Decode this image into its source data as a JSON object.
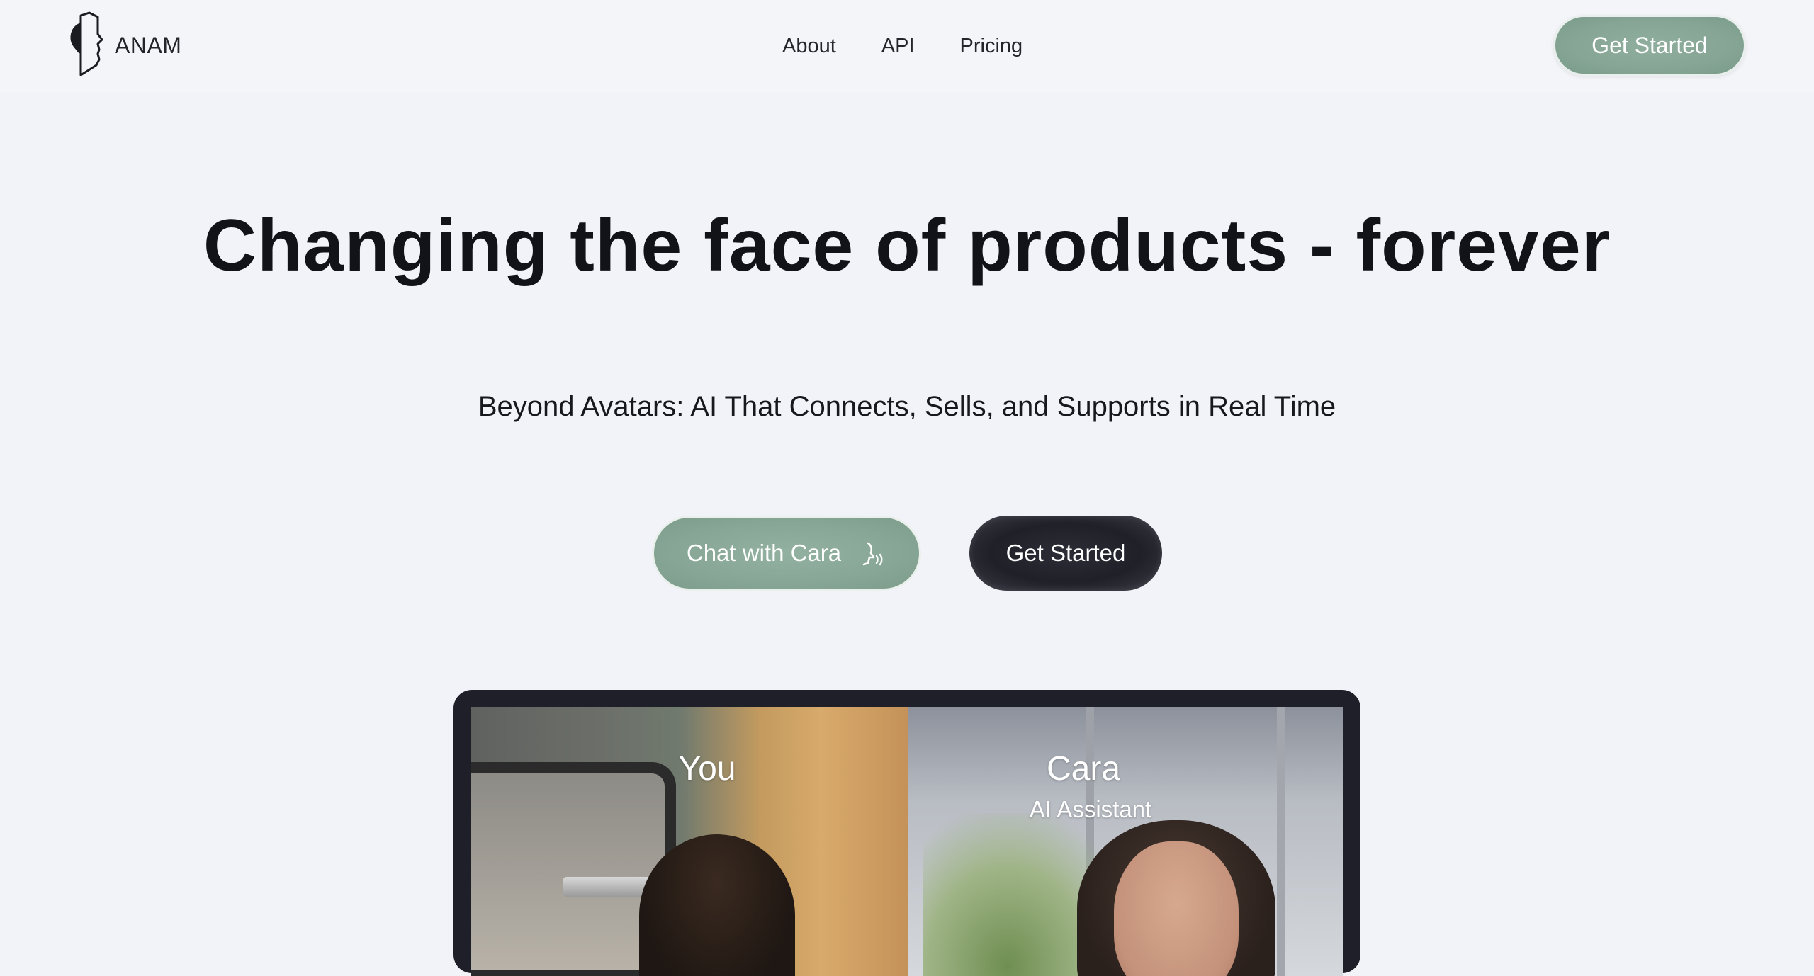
{
  "brand": {
    "name": "ANAM"
  },
  "nav": {
    "items": [
      {
        "label": "About"
      },
      {
        "label": "API"
      },
      {
        "label": "Pricing"
      }
    ]
  },
  "header": {
    "cta_label": "Get Started"
  },
  "hero": {
    "title": "Changing the face of products - forever",
    "subtitle": "Beyond Avatars: AI That Connects, Sells, and Supports in Real Time",
    "primary_cta": "Chat with Cara",
    "primary_cta_icon": "speaking-head-icon",
    "secondary_cta": "Get Started"
  },
  "demo": {
    "you_label": "You",
    "cara_label": "Cara",
    "cara_role": "AI Assistant"
  },
  "colors": {
    "background": "#f2f3f9",
    "sage_button": "#87a696",
    "dark_button": "#1f2028",
    "device_frame": "#1e1f29",
    "text": "#111318"
  }
}
